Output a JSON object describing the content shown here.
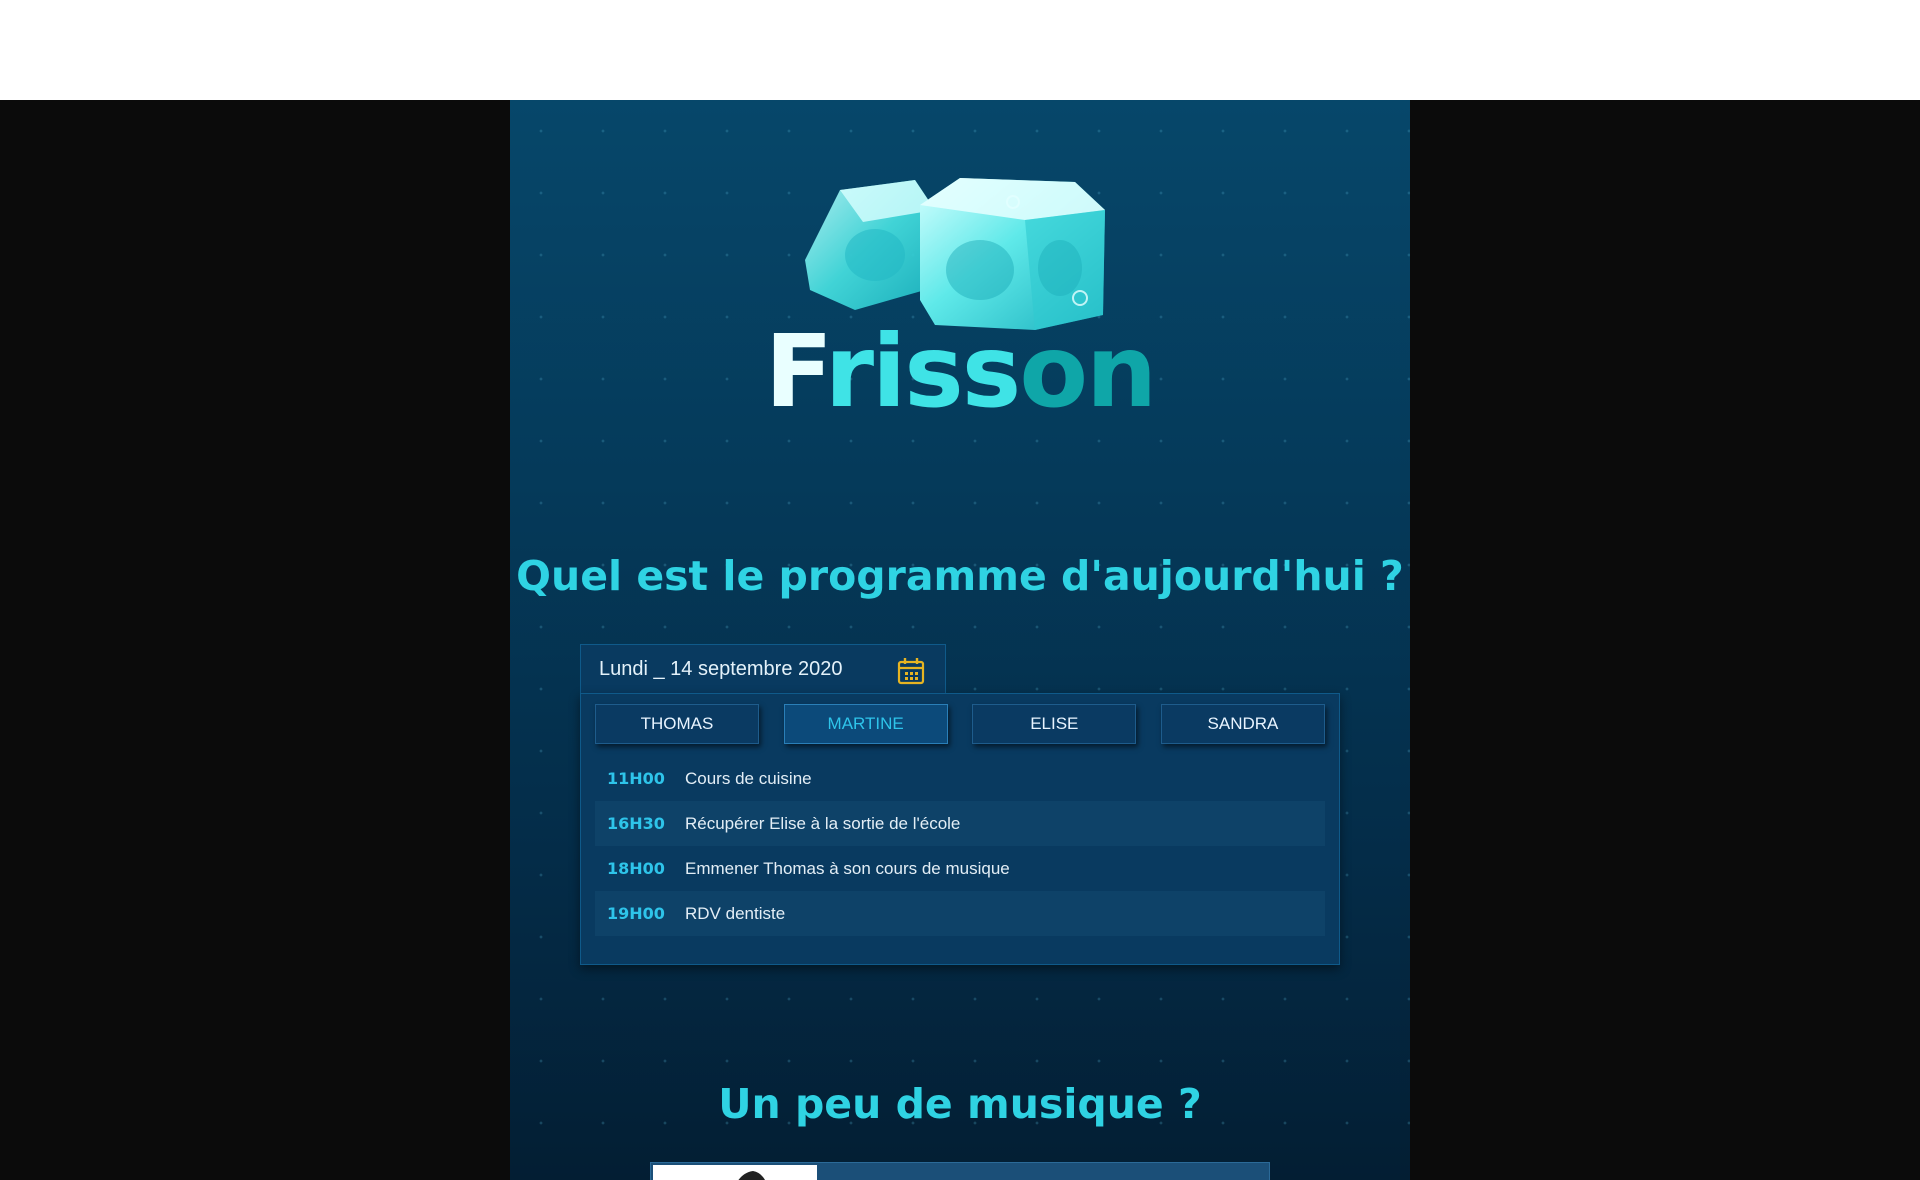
{
  "logo": {
    "brand_part_1": "F",
    "brand_part_2": "riss",
    "brand_part_3": "on"
  },
  "sections": {
    "schedule_title": "Quel est le programme d'aujourd'hui ?",
    "music_title": "Un peu de musique ?"
  },
  "date_picker": {
    "date_text": "Lundi _ 14 septembre 2020",
    "icon": "calendar-icon",
    "icon_color": "#e6b422"
  },
  "people_tabs": [
    {
      "label": "THOMAS",
      "active": false
    },
    {
      "label": "MARTINE",
      "active": true
    },
    {
      "label": "ELISE",
      "active": false
    },
    {
      "label": "SANDRA",
      "active": false
    }
  ],
  "schedule": [
    {
      "time": "11H00",
      "task": "Cours de cuisine"
    },
    {
      "time": "16H30",
      "task": "Récupérer Elise à la sortie de l'école"
    },
    {
      "time": "18H00",
      "task": "Emmener Thomas à son cours de musique"
    },
    {
      "time": "19H00",
      "task": "RDV dentiste"
    }
  ],
  "colors": {
    "accent": "#2fd3e3",
    "active_tab_text": "#2ec4ea",
    "panel_bg": "#053a5a",
    "calendar_icon": "#e6b422"
  }
}
